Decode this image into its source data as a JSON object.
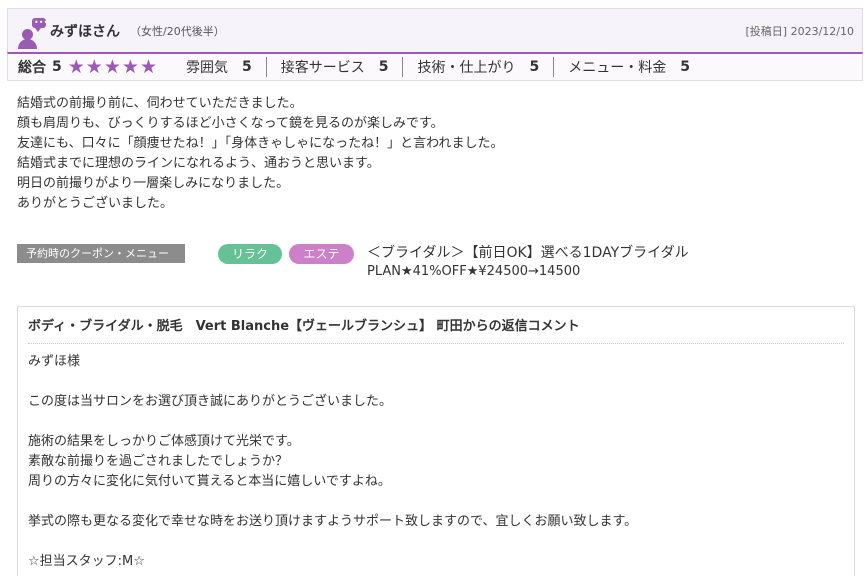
{
  "reviewer": {
    "name": "みずほさん",
    "meta": "（女性/20代後半）",
    "posted": "[投稿日] 2023/12/10"
  },
  "ratings": {
    "overall_label": "総合",
    "overall_score": "5",
    "stars": 5,
    "star_color": "#9b5bb3",
    "categories": [
      {
        "label": "雰囲気",
        "value": "5"
      },
      {
        "label": "接客サービス",
        "value": "5"
      },
      {
        "label": "技術・仕上がり",
        "value": "5"
      },
      {
        "label": "メニュー・料金",
        "value": "5"
      }
    ]
  },
  "review": {
    "lines": [
      "結婚式の前撮り前に、伺わせていただきました。",
      "顔も肩周りも、びっくりするほど小さくなって鏡を見るのが楽しみです。",
      "友達にも、口々に「顔痩せたね！」「身体きゃしゃになったね！」と言われました。",
      "結婚式までに理想のラインになれるよう、通おうと思います。",
      "明日の前撮りがより一層楽しみになりました。",
      "ありがとうございました。"
    ]
  },
  "coupon": {
    "label": "予約時のクーポン・メニュー",
    "tags": [
      "リラク",
      "エステ"
    ],
    "title": "＜ブライダル＞【前日OK】選べる1DAYブライダル",
    "price": "PLAN★41%OFF★¥24500→14500"
  },
  "reply": {
    "title": "ボディ・ブライダル・脱毛　Vert Blanche【ヴェールブランシュ】 町田からの返信コメント",
    "lines": [
      "みずほ様",
      "",
      "この度は当サロンをお選び頂き誠にありがとうございました。",
      "",
      "施術の結果をしっかりご体感頂けて光栄です。",
      "素敵な前撮りを過ごされましたでしょうか？",
      "周りの方々に変化に気付いて貰えると本当に嬉しいですよね。",
      "",
      "挙式の際も更なる変化で幸せな時をお送り頂けますようサポート致しますので、宜しくお願い致します。",
      "",
      "☆担当スタッフ:M☆"
    ]
  }
}
